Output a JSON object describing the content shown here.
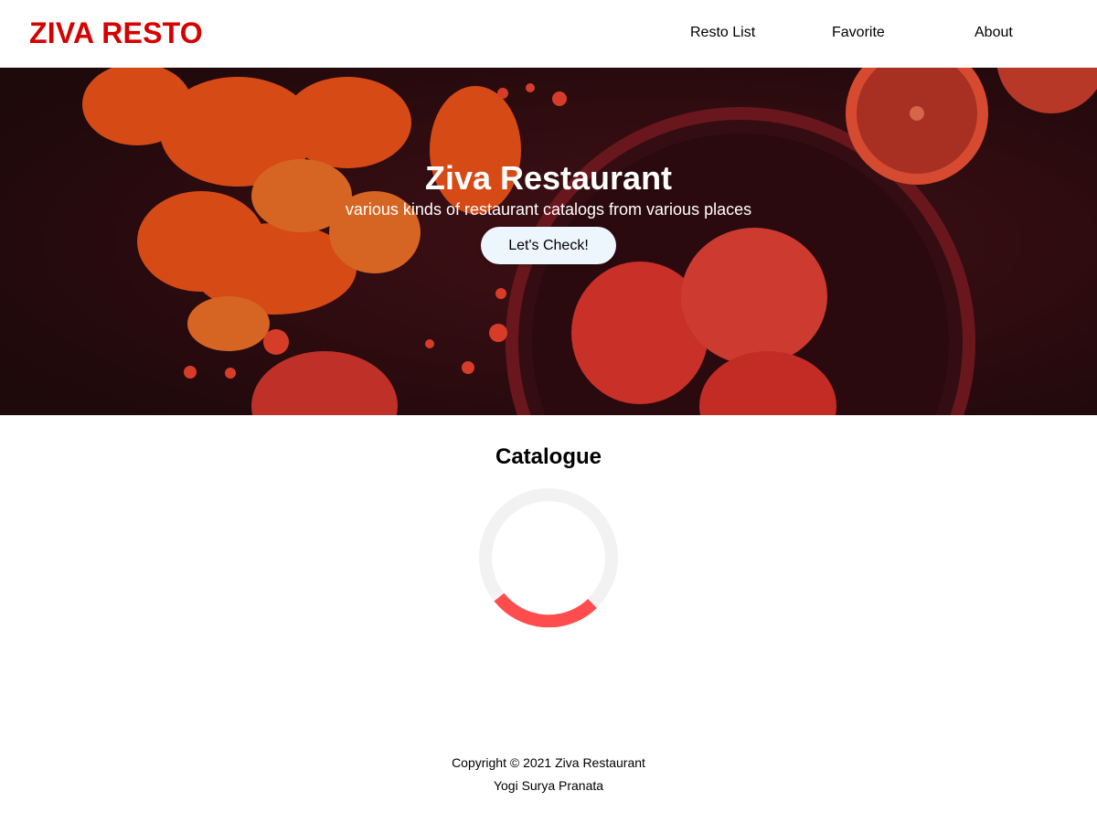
{
  "header": {
    "brand": "ZIVA RESTO",
    "nav": [
      {
        "label": "Resto List"
      },
      {
        "label": "Favorite"
      },
      {
        "label": "About"
      }
    ]
  },
  "hero": {
    "title": "Ziva Restaurant",
    "subtitle": "various kinds of restaurant catalogs from various places",
    "cta_label": "Let's Check!"
  },
  "catalogue": {
    "title": "Catalogue",
    "loader_icon": "spinner-icon"
  },
  "footer": {
    "copyright": "Copyright © 2021 Ziva Restaurant",
    "author": "Yogi Surya Pranata"
  },
  "colors": {
    "brand": "#d50000",
    "loader_accent": "#ff4d4d",
    "loader_track": "#f2f2f2",
    "hero_overlay": "#2b0d12",
    "button_bg": "#eef6fd"
  }
}
